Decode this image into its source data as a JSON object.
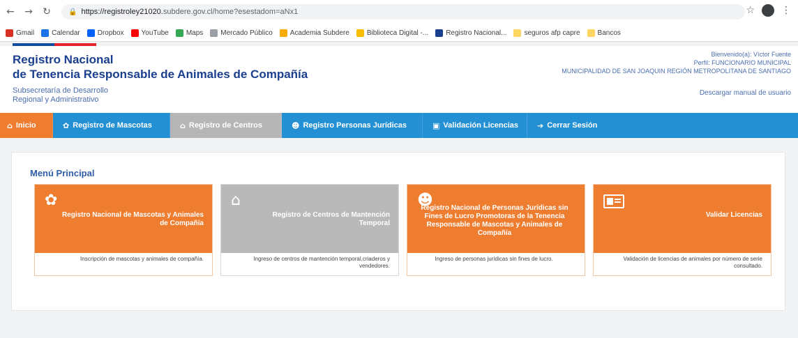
{
  "browser": {
    "url_host": "https://registroley21020.",
    "url_path": "subdere.gov.cl/home?esestadom=aNx1",
    "bookmarks": [
      {
        "label": "Gmail",
        "color": "#d93025"
      },
      {
        "label": "Calendar",
        "color": "#1a73e8"
      },
      {
        "label": "Dropbox",
        "color": "#0061ff"
      },
      {
        "label": "YouTube",
        "color": "#ff0000"
      },
      {
        "label": "Maps",
        "color": "#34a853"
      },
      {
        "label": "Mercado Público",
        "color": "#9aa0a6"
      },
      {
        "label": "Academia Subdere",
        "color": "#f9ab00"
      },
      {
        "label": "Biblioteca Digital -...",
        "color": "#fbbc04"
      },
      {
        "label": "Registro Nacional...",
        "color": "#1a3f8f"
      },
      {
        "label": "seguros afp capre",
        "color": "#fdd663"
      },
      {
        "label": "Bancos",
        "color": "#fdd663"
      }
    ]
  },
  "header": {
    "title_line1": "Registro Nacional",
    "title_line2": "de Tenencia Responsable de Animales de Compañía",
    "subsecretaria_line1": "Subsecretaría de Desarrollo",
    "subsecretaria_line2": "Regional y Administrativo",
    "user_greeting": "Bienvenido(a): Víctor Fuente",
    "user_profile": "Perfil: FUNCIONARIO MUNICIPAL",
    "user_municipality": "MUNICIPALIDAD DE SAN JOAQUIN REGIÓN METROPOLITANA DE SANTIAGO",
    "manual_link": "Descargar manual de usuario"
  },
  "nav": {
    "inicio": "Inicio",
    "mascotas": "Registro de Mascotas",
    "centros": "Registro de Centros",
    "juridicas": "Registro Personas Jurídicas",
    "licencias": "Validación Licencias",
    "cerrar": "Cerrar Sesión"
  },
  "main": {
    "menu_title": "Menú Principal",
    "cards": [
      {
        "title": "Registro Nacional de Mascotas y Animales de Compañía",
        "description": "Inscripción de mascotas y animales de compañía."
      },
      {
        "title": "Registro de Centros de Mantención Temporal",
        "description": "Ingreso de centros de mantención temporal,criaderos y vendedores."
      },
      {
        "title": "Registro Nacional de Personas Jurídicas sin Fines de Lucro Promotoras de la Tenencia Responsable de Mascotas y Animales de Compañía",
        "description": "Ingreso de personas jurídicas sin fines de lucro."
      },
      {
        "title": "Validar Licencias",
        "description": "Validación de licencias de animales por número de serie consultado."
      }
    ]
  },
  "colors": {
    "brand_blue": "#1b3f8f",
    "nav_blue": "#2390d3",
    "accent_orange": "#ee7d30",
    "disabled_grey": "#b9b9b9"
  }
}
